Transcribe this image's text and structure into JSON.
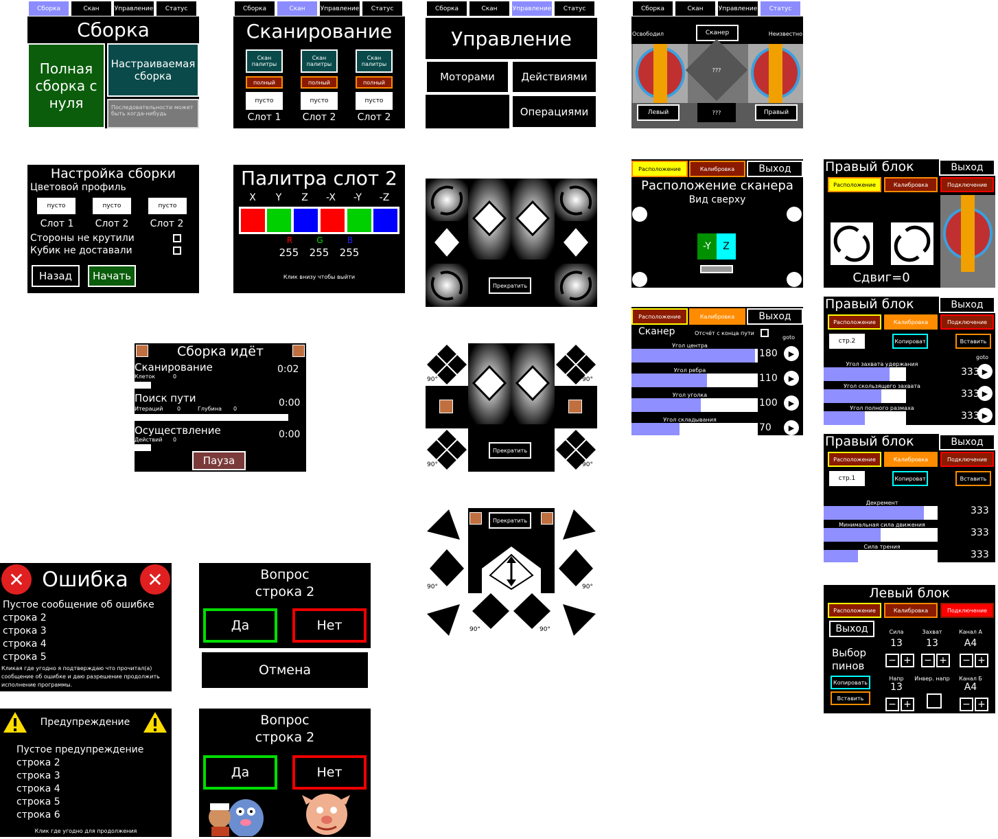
{
  "tabs": [
    "Сборка",
    "Скан",
    "Управление",
    "Статус"
  ],
  "s1": {
    "title": "Сборка",
    "full": "Полная сборка с нуля",
    "custom": "Настраиваемая сборка",
    "seq": "Последовательности может быть когда-нибудь"
  },
  "s2": {
    "title": "Сканирование",
    "scan": "Скан палитры",
    "full": "полный",
    "empty": "пусто",
    "slots": [
      "Слот 1",
      "Слот 2",
      "Слот 2"
    ]
  },
  "s3": {
    "title": "Управление",
    "motors": "Моторами",
    "actions": "Действиями",
    "ops": "Операциями"
  },
  "s4": {
    "left_status": "Освободил",
    "scanner": "Сканер",
    "right_status": "Неизвестно",
    "mid": "???",
    "bottom_mid": "???",
    "left_btn": "Левый",
    "right_btn": "Правый"
  },
  "s5": {
    "title": "Настройка сборки",
    "profile": "Цветовой профиль",
    "empty": "пусто",
    "slots": [
      "Слот 1",
      "Слот 2",
      "Слот 2"
    ],
    "sides": "Стороны не крутили",
    "cube": "Кубик не доставали",
    "back": "Назад",
    "start": "Начать"
  },
  "s6": {
    "title": "Палитра слот 2",
    "axes": [
      "X",
      "Y",
      "Z",
      "-X",
      "-Y",
      "-Z"
    ],
    "r": "R",
    "g": "G",
    "b": "B",
    "rv": "255",
    "gv": "255",
    "bv": "255",
    "hint": "Клик внизу чтобы выйти"
  },
  "s7": {
    "stop": "Прекратить"
  },
  "s8": {
    "stop": "Прекратить",
    "deg": "90°"
  },
  "s9": {
    "stop": "Прекратить",
    "deg": "90°"
  },
  "s10": {
    "t1": "Расположение",
    "t2": "Калибровка",
    "exit": "Выход",
    "title": "Расположение сканера",
    "sub": "Вид сверху",
    "y": "-Y",
    "z": "Z"
  },
  "s11": {
    "t1": "Расположение",
    "t2": "Калибровка",
    "exit": "Выход",
    "scanner": "Сканер",
    "count": "Отсчёт с конца пути",
    "goto": "goto",
    "rows": [
      {
        "label": "Угол центра",
        "val": "180",
        "fill": 0.98
      },
      {
        "label": "Угол ребра",
        "val": "110",
        "fill": 0.6
      },
      {
        "label": "Угол уголка",
        "val": "100",
        "fill": 0.55
      },
      {
        "label": "Угол складывания",
        "val": "70",
        "fill": 0.38
      }
    ]
  },
  "s12": {
    "title": "Правый блок",
    "exit": "Выход",
    "t1": "Расположение",
    "t2": "Калибровка",
    "t3": "Подключение",
    "shift": "Сдвиг=0"
  },
  "s13": {
    "title": "Правый блок",
    "exit": "Выход",
    "t1": "Расположение",
    "t2": "Калибровка",
    "t3": "Подключение",
    "page": "стр.2",
    "copy": "Копироват",
    "paste": "Вставить",
    "goto": "goto",
    "rows": [
      {
        "label": "Угол захвата удержания",
        "val": "333",
        "fill": 0.8
      },
      {
        "label": "Угол скользящего захвата",
        "val": "333",
        "fill": 0.7
      },
      {
        "label": "Угол полного размаха",
        "val": "333",
        "fill": 0.5
      }
    ]
  },
  "s14": {
    "title": "Правый блок",
    "exit": "Выход",
    "t1": "Расположение",
    "t2": "Калибровка",
    "t3": "Подключение",
    "page": "стр.1",
    "copy": "Копироват",
    "paste": "Вставить",
    "rows": [
      {
        "label": "Декремент",
        "val": "333",
        "fill": 0.88
      },
      {
        "label": "Минимальная сила движения",
        "val": "333",
        "fill": 0.5
      },
      {
        "label": "Сила трения",
        "val": "333",
        "fill": 0.3
      }
    ]
  },
  "s15": {
    "title": "Сборка идёт",
    "scan": "Сканирование",
    "scan_time": "0:02",
    "cells": "Клеток",
    "cells_v": "0",
    "path": "Поиск пути",
    "path_time": "0:00",
    "iter": "Итераций",
    "iter_v": "0",
    "depth": "Глубина",
    "depth_v": "0",
    "exec": "Осуществление",
    "exec_time": "0:00",
    "acts": "Действий",
    "acts_v": "0",
    "pause": "Пауза"
  },
  "s16": {
    "title": "Левый блок",
    "t1": "Расположение",
    "t2": "Калибровка",
    "t3": "Подключение",
    "exit": "Выход",
    "pins": "Выбор пинов",
    "copy": "Копировать",
    "paste": "Вставить",
    "cols": [
      {
        "l": "Сила",
        "v": "13"
      },
      {
        "l": "Захват",
        "v": "13"
      },
      {
        "l": "Канал А",
        "v": "A4"
      }
    ],
    "cols2": [
      {
        "l": "Напр",
        "v": "13"
      },
      {
        "l": "Инвер. напр",
        "v": ""
      },
      {
        "l": "Канал Б",
        "v": "A4"
      }
    ]
  },
  "s17": {
    "title": "Ошибка",
    "lines": [
      "Пустое сообщение об ошибке",
      "строка 2",
      "строка 3",
      "строка 4",
      "строка 5"
    ],
    "foot": "Кликая где угодно я подтверждаю что прочитал(а) сообщение об ошибке и даю разрешение продолжить исполнение программы."
  },
  "s18": {
    "q1": "Вопрос",
    "q2": "строка 2",
    "yes": "Да",
    "no": "Нет",
    "cancel": "Отмена"
  },
  "s19": {
    "title": "Предупреждение",
    "lines": [
      "Пустое предупреждение",
      "строка 2",
      "строка 3",
      "строка 4",
      "строка 5",
      "строка 6"
    ],
    "foot": "Клик где угодно для продолжения"
  },
  "s20": {
    "q1": "Вопрос",
    "q2": "строка 2",
    "yes": "Да",
    "no": "Нет"
  },
  "colors": {
    "accent": "#8c8cff",
    "orange": "#ff8c00",
    "dark_red": "#8b1a00",
    "green": "#0b5d0b",
    "teal": "#0a4a4a",
    "yellow": "#ffff00"
  }
}
